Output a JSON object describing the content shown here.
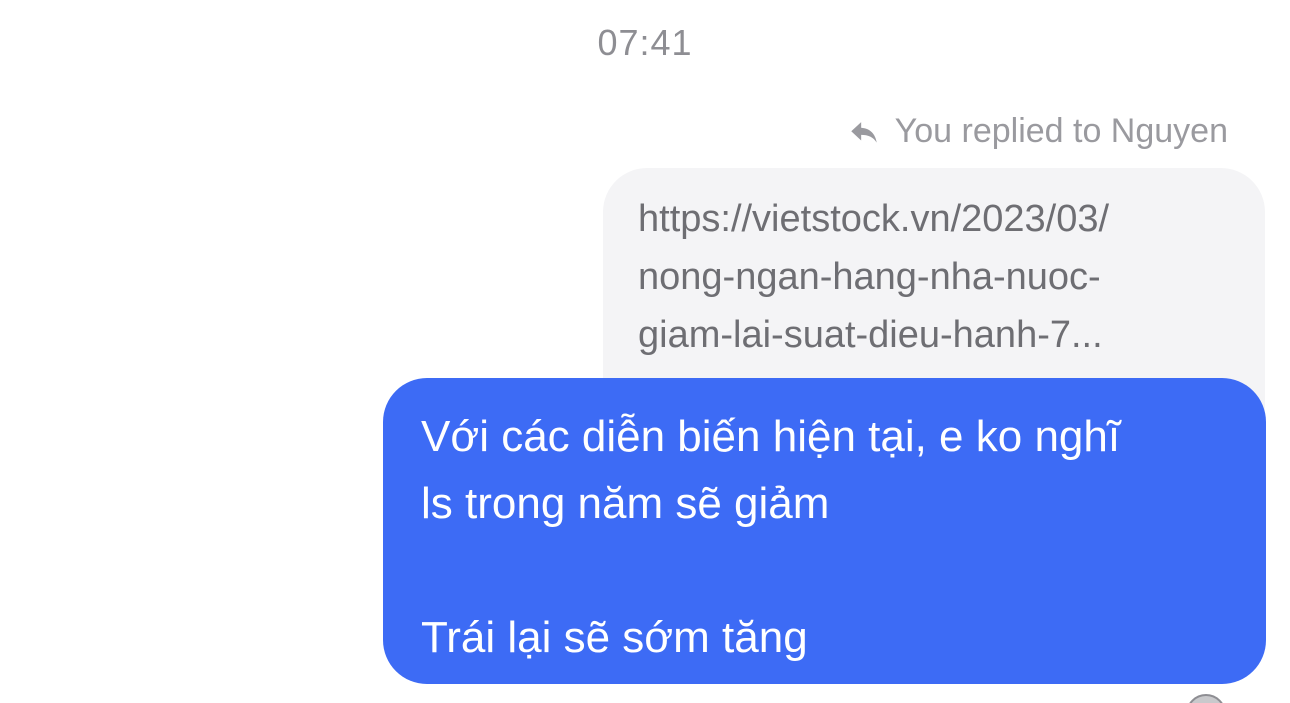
{
  "conversation": {
    "timestamp": "07:41",
    "reply_indicator": {
      "icon": "reply-arrow-icon",
      "text": "You replied to Nguyen"
    },
    "quoted_message": {
      "lines": [
        "https://vietstock.vn/2023/03/",
        "nong-ngan-hang-nha-nuoc-",
        "giam-lai-suat-dieu-hanh-7..."
      ]
    },
    "sent_message": {
      "lines": [
        "Với các diễn biến hiện tại, e ko nghĩ",
        "ls trong năm sẽ giảm",
        "",
        "Trái lại sẽ sớm tăng"
      ]
    },
    "seen_avatar": "avatar"
  },
  "colors": {
    "sent_bubble": "#3d6bf5",
    "quoted_bubble": "#f4f4f6",
    "meta_text": "#8e8e93"
  }
}
